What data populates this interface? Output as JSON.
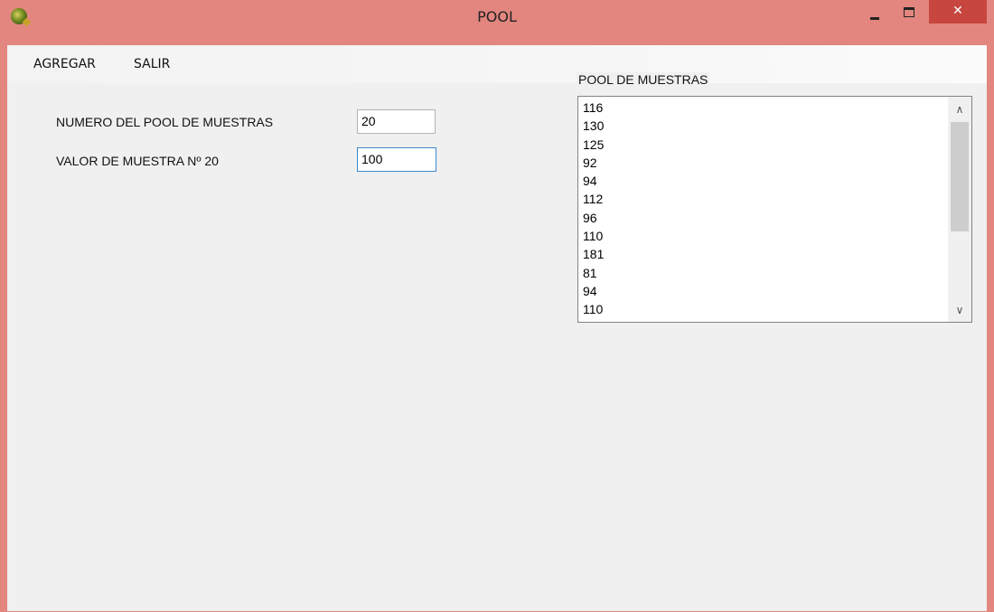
{
  "window": {
    "title": "POOL",
    "close_glyph": "✕"
  },
  "menu": {
    "items": [
      {
        "label": "AGREGAR"
      },
      {
        "label": "SALIR"
      }
    ]
  },
  "form": {
    "pool_number_label": "NUMERO DEL POOL DE MUESTRAS",
    "pool_number_value": "20",
    "sample_value_label": "VALOR DE MUESTRA Nº  20",
    "sample_value_value": "100"
  },
  "pool": {
    "title": "POOL DE MUESTRAS",
    "items": [
      "116",
      "130",
      "125",
      "92",
      "94",
      "112",
      "96",
      "110",
      "181",
      "81",
      "94",
      "110"
    ]
  },
  "icons": {
    "app": "app-icon",
    "minimize": "minimize-icon",
    "maximize": "maximize-icon",
    "close": "close-icon",
    "scroll_up": "chevron-up-icon",
    "scroll_down": "chevron-down-icon"
  },
  "colors": {
    "titlebar": "#e2867f",
    "close_button": "#c7463f",
    "client_background": "#f0f0f0",
    "focus_border": "#3c88d0"
  }
}
